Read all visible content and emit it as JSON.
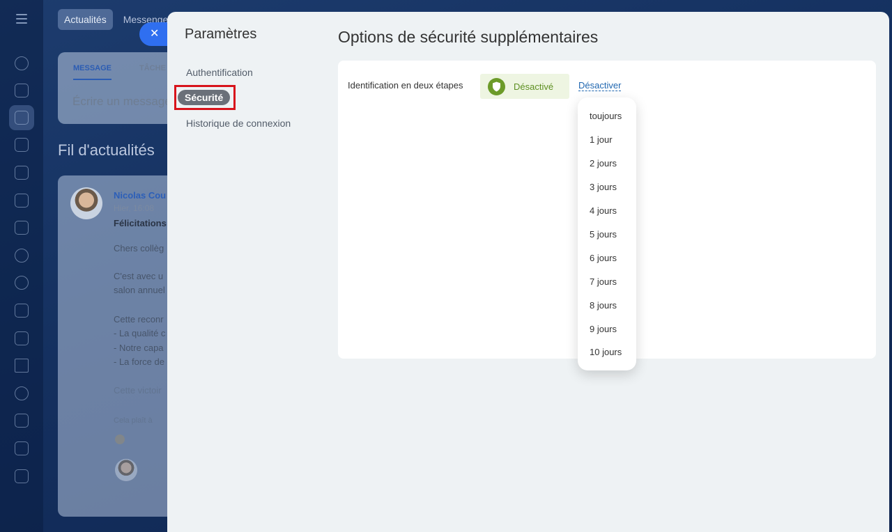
{
  "background": {
    "top_tabs": [
      "Actualités",
      "Messenger"
    ],
    "composer": {
      "tabs": [
        "MESSAGE",
        "TÂCHE"
      ],
      "placeholder": "Écrire un message"
    },
    "feed_title": "Fil d'actualités",
    "post": {
      "author": "Nicolas Cou",
      "time": "Hier, 16:08",
      "subject": "Félicitations",
      "lines": [
        "Chers collèg",
        "C'est avec u",
        "salon annuel",
        "Cette reconr",
        "- La qualité c",
        "- Notre capa",
        "- La force de",
        "Cette victoir",
        "Cela plaît à"
      ]
    }
  },
  "settings": {
    "sidebar_title": "Paramètres",
    "items": [
      {
        "label": "Authentification"
      },
      {
        "label": "Sécurité"
      },
      {
        "label": "Historique de connexion"
      }
    ],
    "main_title": "Options de sécurité supplémentaires",
    "two_step": {
      "label": "Identification en deux étapes",
      "status": "Désactivé",
      "action": "Désactiver"
    },
    "menu_options": [
      "toujours",
      "1 jour",
      "2 jours",
      "3 jours",
      "4 jours",
      "5 jours",
      "6 jours",
      "7 jours",
      "8 jours",
      "9 jours",
      "10 jours"
    ]
  },
  "colors": {
    "accent_blue": "#2f6ff0",
    "highlight_red": "#d8141c",
    "status_green": "#6c9b29"
  }
}
